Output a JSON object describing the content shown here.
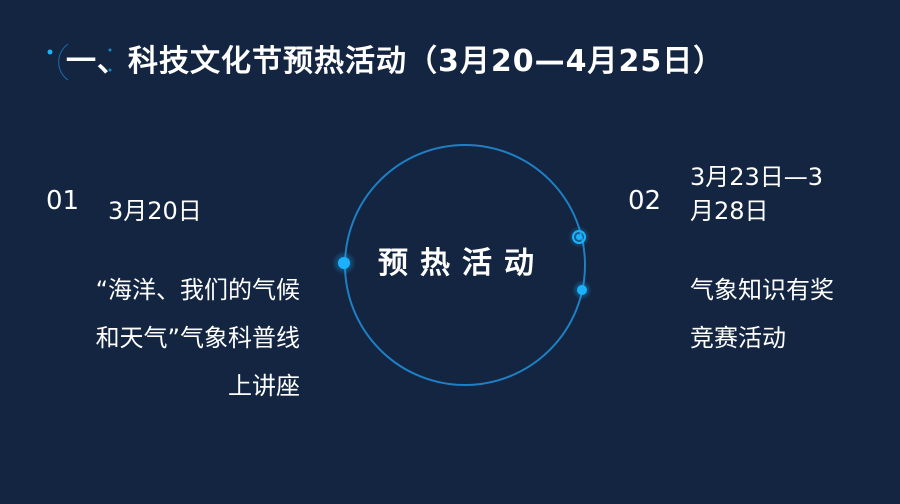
{
  "title": "一、科技文化节预热活动（3月20—4月25日）",
  "center_label": "预热活动",
  "items": [
    {
      "number": "01",
      "date": "3月20日",
      "description": "“海洋、我们的气候和天气”气象科普线上讲座"
    },
    {
      "number": "02",
      "date": "3月23日—3月28日",
      "description": "气象知识有奖竞赛活动"
    }
  ],
  "colors": {
    "background": "#132540",
    "accent": "#1ab2ff",
    "ring": "#1e7fc4",
    "text": "#ffffff"
  }
}
